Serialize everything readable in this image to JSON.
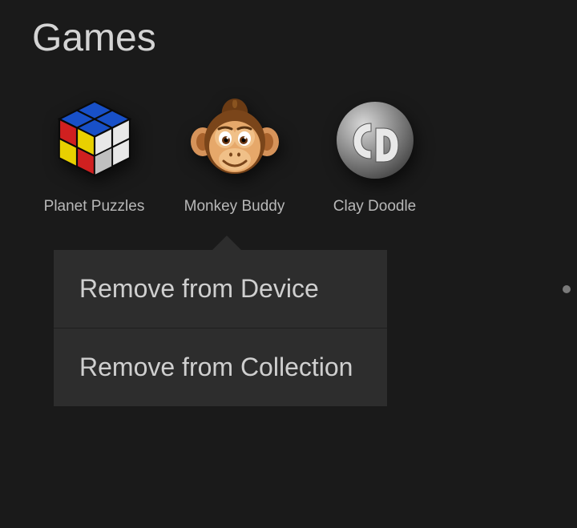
{
  "header": {
    "title": "Games"
  },
  "games": [
    {
      "label": "Planet Puzzles",
      "icon": "cube-icon"
    },
    {
      "label": "Monkey Buddy",
      "icon": "monkey-icon"
    },
    {
      "label": "Clay Doodle",
      "icon": "clay-doodle-icon"
    }
  ],
  "context_menu": {
    "items": [
      {
        "label": "Remove from Device"
      },
      {
        "label": "Remove from Collection"
      }
    ]
  },
  "page_indicator": {
    "active_index": 0,
    "total": 1
  }
}
